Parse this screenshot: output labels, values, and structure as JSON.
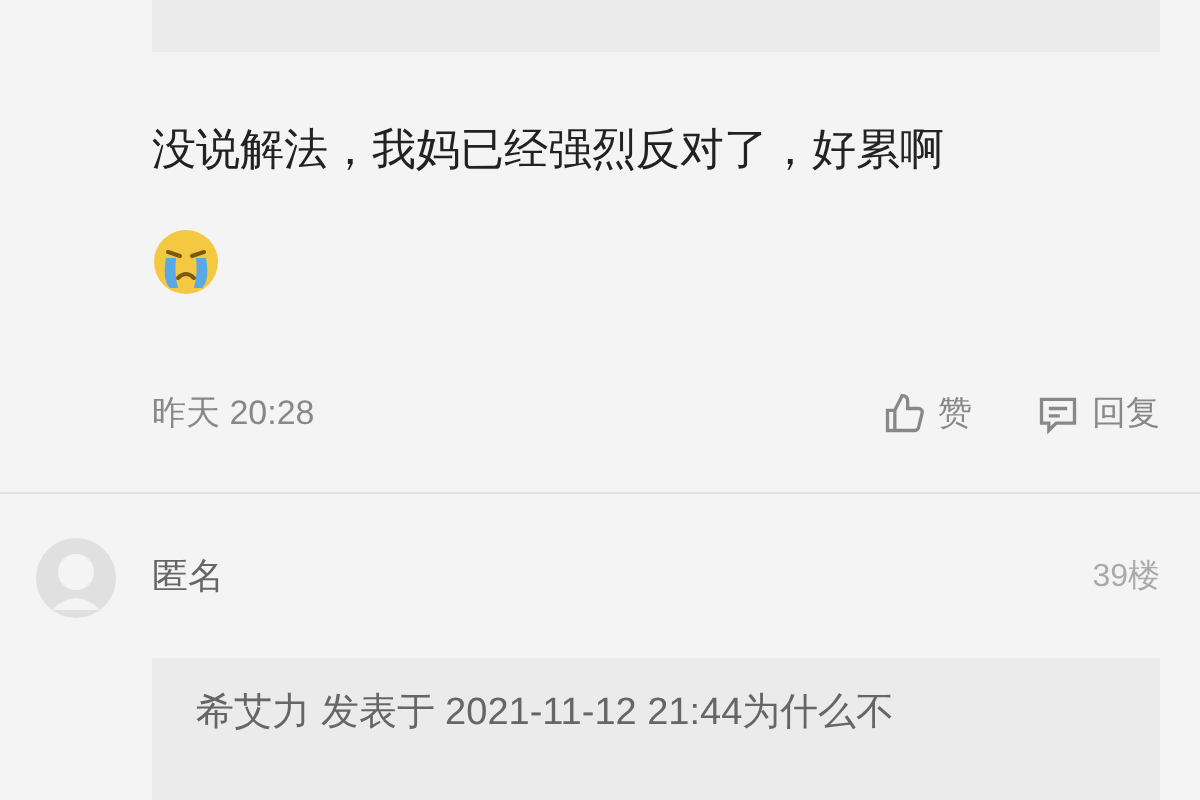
{
  "comments": [
    {
      "body": "没说解法，我妈已经强烈反对了，好累啊",
      "time": "昨天 20:28",
      "like_label": "赞",
      "reply_label": "回复"
    },
    {
      "author": "匿名",
      "floor": "39楼",
      "quote": "希艾力 发表于 2021-11-12 21:44为什么不"
    }
  ]
}
